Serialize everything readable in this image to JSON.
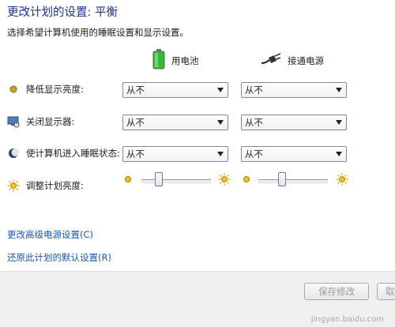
{
  "page": {
    "title": "更改计划的设置: 平衡",
    "subtitle": "选择希望计算机使用的睡眠设置和显示设置。"
  },
  "columns": {
    "battery": {
      "label": "用电池",
      "icon": "battery-icon"
    },
    "plugged": {
      "label": "接通电源",
      "icon": "power-plug-icon"
    }
  },
  "rows": [
    {
      "label": "降低显示亮度:",
      "icon": "dim-display-icon",
      "battery": "从不",
      "plugged": "从不"
    },
    {
      "label": "关闭显示器:",
      "icon": "monitor-off-icon",
      "battery": "从不",
      "plugged": "从不"
    },
    {
      "label": "使计算机进入睡眠状态:",
      "icon": "sleep-moon-icon",
      "battery": "从不",
      "plugged": "从不"
    }
  ],
  "brightness": {
    "label": "调整计划亮度:",
    "icon": "brightness-icon",
    "battery_level": 0.22,
    "plugged_level": 0.32
  },
  "links": {
    "advanced": "更改高级电源设置(C)",
    "restore": "还原此计划的默认设置(R)"
  },
  "buttons": {
    "save": "保存修改",
    "cancel": "取消"
  },
  "watermark": "jingyan.baidu.com",
  "colors": {
    "title": "#1e3287",
    "link": "#1a56b8",
    "battery_green": "#3cb53c"
  }
}
